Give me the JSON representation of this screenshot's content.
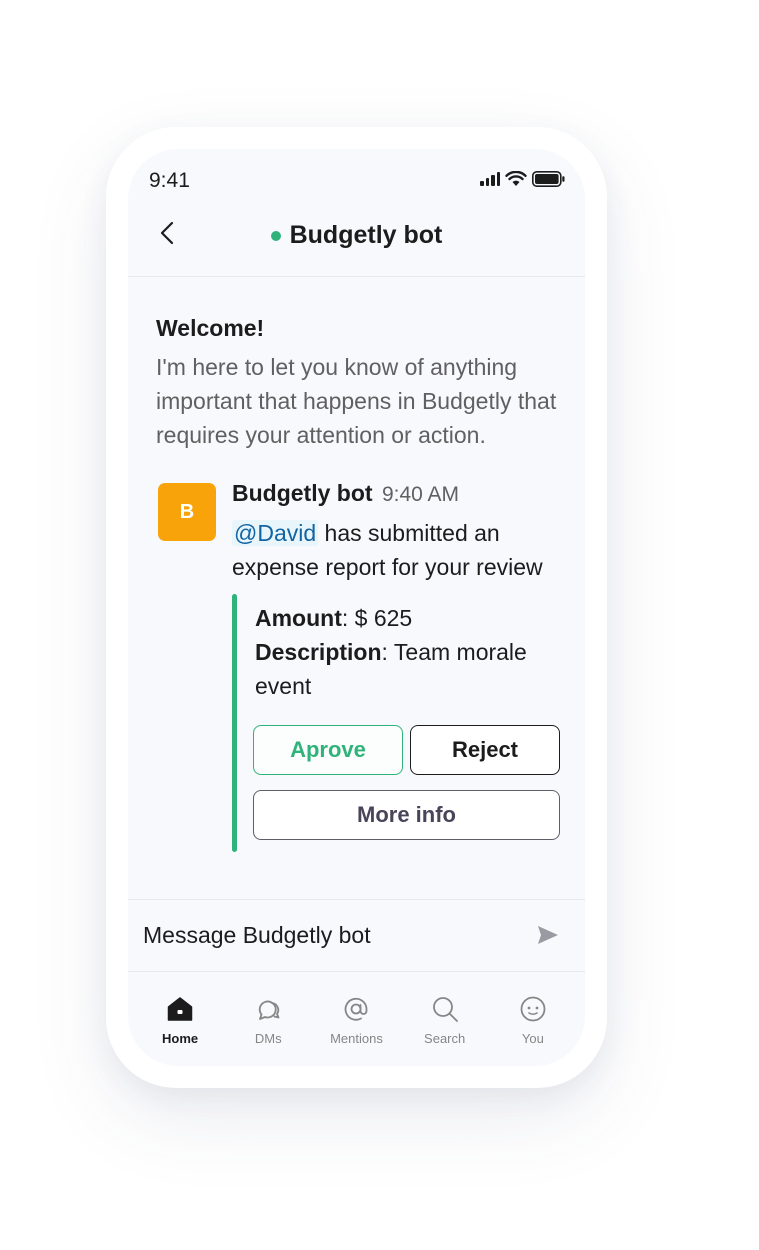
{
  "status_bar": {
    "time": "9:41"
  },
  "header": {
    "title": "Budgetly bot"
  },
  "welcome": {
    "title": "Welcome!",
    "text": "I'm here to let you know of anything important that happens in Budgetly that requires your attention or action."
  },
  "message": {
    "avatar_letter": "B",
    "sender": "Budgetly bot",
    "time": "9:40 AM",
    "mention": "@David",
    "text": " has submitted an expense report for your review",
    "attachment": {
      "amount_label": "Amount",
      "amount_value": ": $ 625",
      "description_label": "Description",
      "description_value": ": Team morale event"
    },
    "buttons": {
      "approve": "Aprove",
      "reject": "Reject",
      "more_info": "More info"
    }
  },
  "composer": {
    "placeholder": "Message Budgetly bot"
  },
  "nav": [
    {
      "label": "Home",
      "icon": "home-icon",
      "active": true
    },
    {
      "label": "DMs",
      "icon": "dms-icon",
      "active": false
    },
    {
      "label": "Mentions",
      "icon": "mentions-icon",
      "active": false
    },
    {
      "label": "Search",
      "icon": "search-icon",
      "active": false
    },
    {
      "label": "You",
      "icon": "you-icon",
      "active": false
    }
  ],
  "colors": {
    "accent_green": "#2fb37a",
    "avatar_orange": "#f9a30a",
    "mention_blue": "#1264a3"
  }
}
